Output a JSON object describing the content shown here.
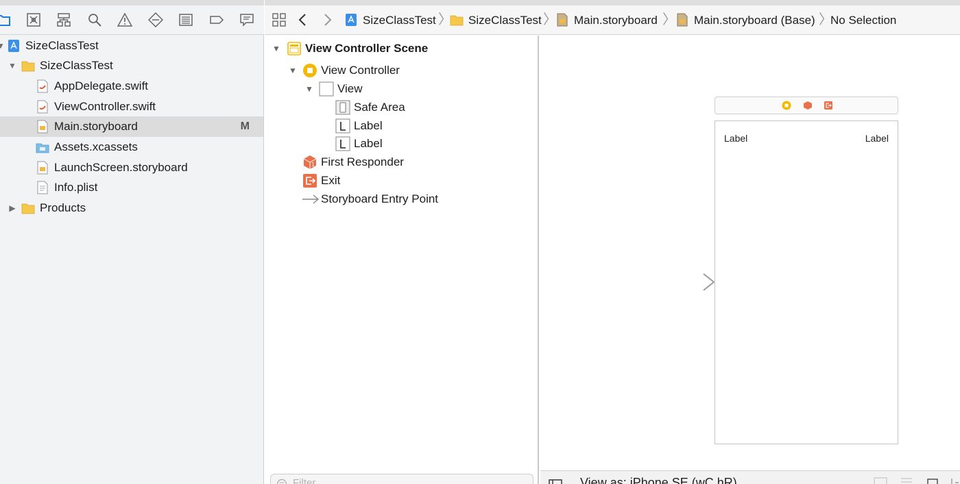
{
  "navigator": {
    "tabs": [
      {
        "name": "project-navigator-icon",
        "icon": "folder"
      },
      {
        "name": "source-control-navigator-icon",
        "icon": "x-box"
      },
      {
        "name": "symbol-navigator-icon",
        "icon": "hierarchy"
      },
      {
        "name": "find-navigator-icon",
        "icon": "magnifier"
      },
      {
        "name": "issue-navigator-icon",
        "icon": "warning"
      },
      {
        "name": "test-navigator-icon",
        "icon": "diamond"
      },
      {
        "name": "debug-navigator-icon",
        "icon": "list"
      },
      {
        "name": "breakpoint-navigator-icon",
        "icon": "tag"
      },
      {
        "name": "report-navigator-icon",
        "icon": "speech-bubble"
      }
    ],
    "tree": {
      "project": "SizeClassTest",
      "group": "SizeClassTest",
      "files": [
        {
          "label": "AppDelegate.swift",
          "icon": "swift-file-icon",
          "badge": ""
        },
        {
          "label": "ViewController.swift",
          "icon": "swift-file-icon",
          "badge": ""
        },
        {
          "label": "Main.storyboard",
          "icon": "storyboard-file-icon",
          "badge": "M"
        },
        {
          "label": "Assets.xcassets",
          "icon": "asset-catalog-icon",
          "badge": ""
        },
        {
          "label": "LaunchScreen.storyboard",
          "icon": "storyboard-file-icon",
          "badge": ""
        },
        {
          "label": "Info.plist",
          "icon": "plist-file-icon",
          "badge": ""
        }
      ],
      "products": "Products"
    }
  },
  "jumpbar": {
    "crumbs": [
      "SizeClassTest",
      "SizeClassTest",
      "Main.storyboard",
      "Main.storyboard (Base)",
      "No Selection"
    ]
  },
  "outline": {
    "scene": "View Controller Scene",
    "view_controller": "View Controller",
    "view": "View",
    "safe_area": "Safe Area",
    "label_1": "Label",
    "label_2": "Label",
    "first_responder": "First Responder",
    "exit": "Exit",
    "entry_point": "Storyboard Entry Point",
    "filter_placeholder": "Filter"
  },
  "canvas": {
    "label_left": "Label",
    "label_right": "Label"
  },
  "bottombar": {
    "view_as": "View as: iPhone SE (wC hR)"
  },
  "colors": {
    "selection": "#dcdcdc",
    "folder_yellow": "#f5c74a",
    "vc_yellow": "#f5b800",
    "responder_orange": "#e8704a",
    "blue_accent": "#1e88e5"
  }
}
